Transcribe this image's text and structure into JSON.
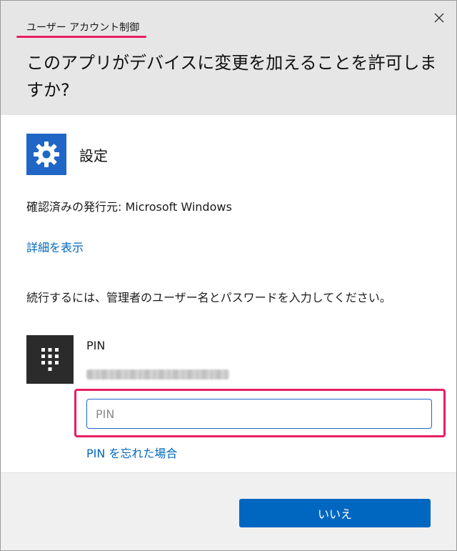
{
  "window": {
    "title": "ユーザー アカウント制御",
    "question": "このアプリがデバイスに変更を加えることを許可しますか?",
    "close_label": "×"
  },
  "app": {
    "name": "設定",
    "icon": "gear-icon"
  },
  "publisher_line": "確認済みの発行元: Microsoft Windows",
  "details_link": "詳細を表示",
  "instruction": "続行するには、管理者のユーザー名とパスワードを入力してください。",
  "credential": {
    "tile_icon": "keypad-icon",
    "label": "PIN",
    "input_placeholder": "PIN",
    "input_value": "",
    "forgot_link": "PIN を忘れた場合"
  },
  "buttons": {
    "no": "いいえ"
  },
  "colors": {
    "accent": "#0067c0",
    "highlight": "#e91e63",
    "header_bg": "#e6e6e6",
    "app_icon_bg": "#1f66c7"
  }
}
